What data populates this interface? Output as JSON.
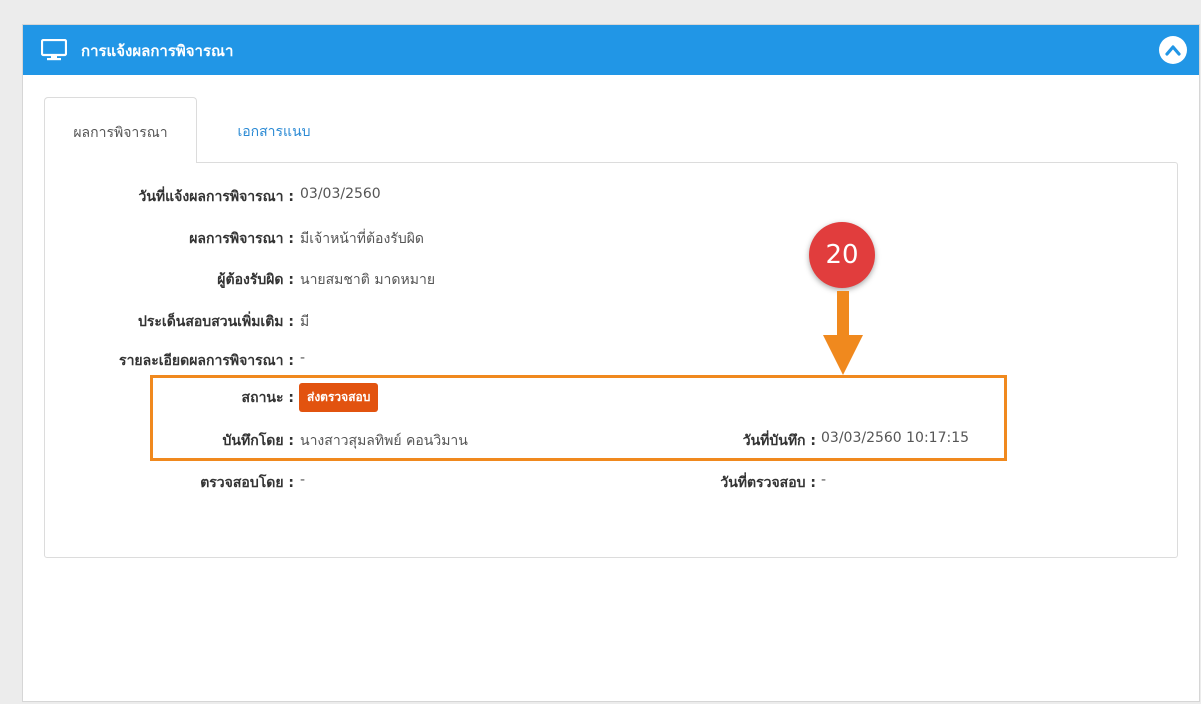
{
  "panel": {
    "title": "การแจ้งผลการพิจารณา",
    "header_color": "#2196e6"
  },
  "tabs": [
    {
      "label": "ผลการพิจารณา",
      "active": true
    },
    {
      "label": "เอกสารแนบ",
      "active": false
    }
  ],
  "fields": {
    "notify_date_label": "วันที่แจ้งผลการพิจารณา :",
    "notify_date_value": "03/03/2560",
    "result_label": "ผลการพิจารณา :",
    "result_value": "มีเจ้าหน้าที่ต้องรับผิด",
    "responsible_label": "ผู้ต้องรับผิด :",
    "responsible_value": "นายสมชาติ มาดหมาย",
    "additional_issue_label": "ประเด็นสอบสวนเพิ่มเติม :",
    "additional_issue_value": "มี",
    "details_label": "รายละเอียดผลการพิจารณา :",
    "details_value": "-",
    "status_label": "สถานะ :",
    "status_value": "ส่งตรวจสอบ",
    "recorded_by_label": "บันทึกโดย :",
    "recorded_by_value": "นางสาวสุมลทิพย์ คอนวิมาน",
    "recorded_date_label": "วันที่บันทึก :",
    "recorded_date_value": "03/03/2560 10:17:15",
    "checked_by_label": "ตรวจสอบโดย :",
    "checked_by_value": "-",
    "checked_date_label": "วันที่ตรวจสอบ :",
    "checked_date_value": "-"
  },
  "annotation": {
    "step_number": "20",
    "accent_color": "#f0891e",
    "badge_color": "#e13d3d"
  },
  "icons": {
    "header": "monitor-icon",
    "collapse": "chevron-up-icon"
  }
}
